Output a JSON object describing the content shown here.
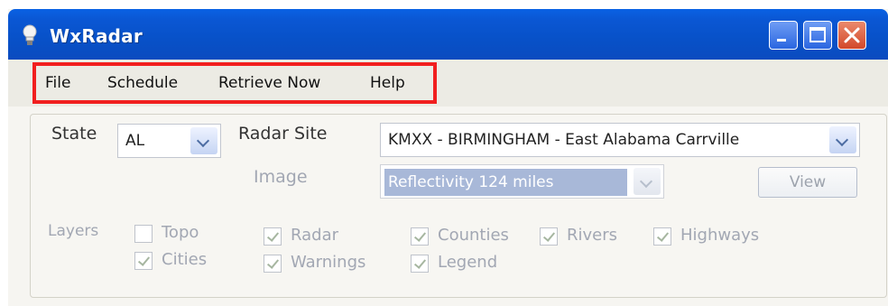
{
  "window": {
    "title": "WxRadar"
  },
  "menu": [
    "File",
    "Schedule",
    "Retrieve Now",
    "Help"
  ],
  "form": {
    "state_label": "State",
    "state_value": "AL",
    "radar_site_label": "Radar Site",
    "radar_site_value": "KMXX - BIRMINGHAM - East Alabama Carrville",
    "image_label": "Image",
    "image_value": "Reflectivity 124 miles",
    "view_button": "View",
    "layers_label": "Layers",
    "layers": {
      "topo": {
        "label": "Topo",
        "checked": false
      },
      "cities": {
        "label": "Cities",
        "checked": true
      },
      "radar": {
        "label": "Radar",
        "checked": true
      },
      "warnings": {
        "label": "Warnings",
        "checked": true
      },
      "counties": {
        "label": "Counties",
        "checked": true
      },
      "legend": {
        "label": "Legend",
        "checked": true
      },
      "rivers": {
        "label": "Rivers",
        "checked": true
      },
      "highways": {
        "label": "Highways",
        "checked": true
      }
    }
  },
  "colors": {
    "titlebar": "#0a57d4",
    "highlight": "#f11f1f",
    "close_button": "#d2482a"
  }
}
